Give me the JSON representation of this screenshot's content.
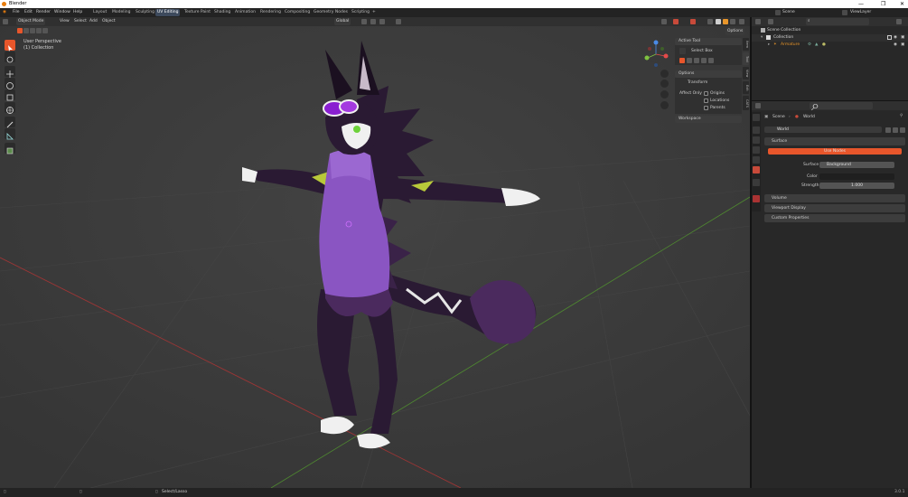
{
  "window": {
    "title": "Blender",
    "controls": [
      "—",
      "❐",
      "✕"
    ]
  },
  "menubar": {
    "menus": [
      "File",
      "Edit",
      "Render",
      "Window",
      "Help"
    ],
    "workspaces": [
      "Layout",
      "Modeling",
      "Sculpting",
      "UV Editing",
      "Texture Paint",
      "Shading",
      "Animation",
      "Rendering",
      "Compositing",
      "Geometry Nodes",
      "Scripting"
    ],
    "active_workspace": "UV Editing",
    "add_tab": "+",
    "scene_label": "Scene",
    "viewlayer_label": "ViewLayer"
  },
  "viewport_header": {
    "mode": "Object Mode",
    "menus": [
      "View",
      "Select",
      "Add",
      "Object"
    ],
    "orientation": "Global",
    "options_label": "Options"
  },
  "viewport": {
    "perspective": "User Perspective",
    "collection": "(1) Collection"
  },
  "npanel": {
    "tabs": [
      "Item",
      "Tool",
      "View",
      "Edit",
      "CATS"
    ],
    "active_tool_header": "Active Tool",
    "select_box": "Select Box",
    "options_header": "Options",
    "transform_header": "Transform",
    "affect_only_label": "Affect Only",
    "checkboxes": [
      "Origins",
      "Locations",
      "Parents"
    ],
    "workspace_header": "Workspace"
  },
  "outliner": {
    "root": "Scene Collection",
    "items": [
      {
        "label": "Collection",
        "depth": 1
      },
      {
        "label": "Armature",
        "depth": 2
      }
    ]
  },
  "properties": {
    "breadcrumb": [
      "Scene",
      "World"
    ],
    "world_name": "World",
    "panels": {
      "surface": "Surface",
      "use_nodes": "Use Nodes",
      "surface_label": "Surface",
      "surface_value": "Background",
      "color_label": "Color",
      "strength_label": "Strength",
      "strength_value": "1.000",
      "volume": "Volume",
      "viewport_display": "Viewport Display",
      "custom_properties": "Custom Properties"
    }
  },
  "statusbar": {
    "hint": "Select/Lasso",
    "version": "3.0.1"
  },
  "colors": {
    "accent": "#e8562b",
    "fur_dark": "#2a1a33",
    "fur_purple": "#4b2a5e",
    "sweater": "#8a55c2",
    "lime": "#b8c93a",
    "gizmo_x": "#e54a4a",
    "gizmo_y": "#7fc240",
    "gizmo_z": "#4a8ae5"
  }
}
